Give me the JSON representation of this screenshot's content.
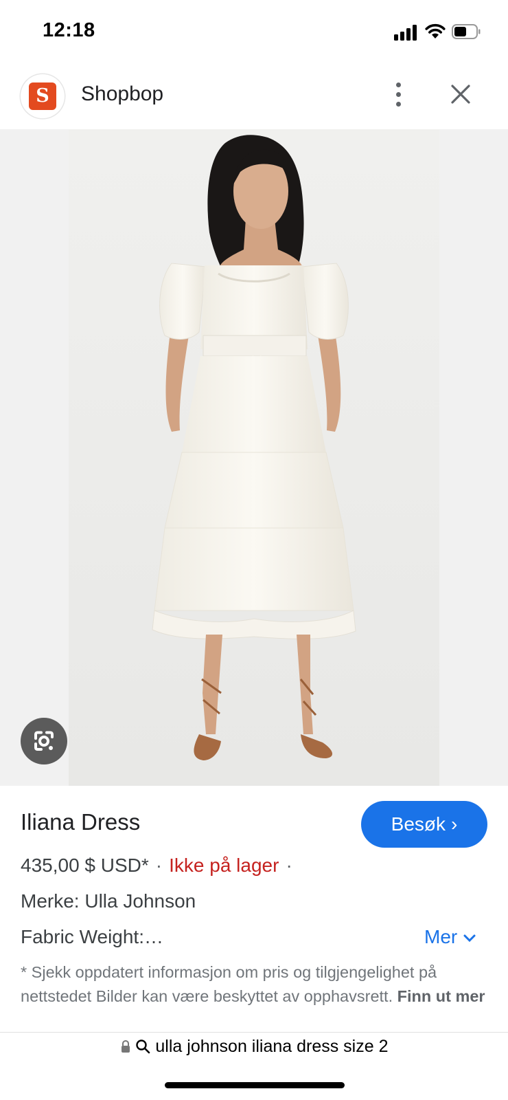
{
  "status_bar": {
    "time": "12:18"
  },
  "header": {
    "site_logo_letter": "S",
    "site_name": "Shopbop",
    "icons": [
      "more-vert-icon",
      "close-icon"
    ]
  },
  "image": {
    "lens_icon": "google-lens-icon"
  },
  "product": {
    "title": "Iliana Dress",
    "visit_label": "Besøk",
    "price": "435,00 $ USD*",
    "stock": "Ikke på lager",
    "brand": "Merke: Ulla Johnson",
    "fabric": "Fabric Weight:…",
    "more_label": "Mer",
    "disclaimer": "* Sjekk oppdatert informasjon om pris og tilgjengelighet på nettstedet Bilder kan være beskyttet av opphavsrett.",
    "learn_more": "Finn ut mer"
  },
  "url_bar": {
    "text": "ulla johnson iliana dress size 2"
  },
  "colors": {
    "accent": "#1a73e8",
    "stock_red": "#c5221f",
    "logo": "#e34a1f"
  }
}
